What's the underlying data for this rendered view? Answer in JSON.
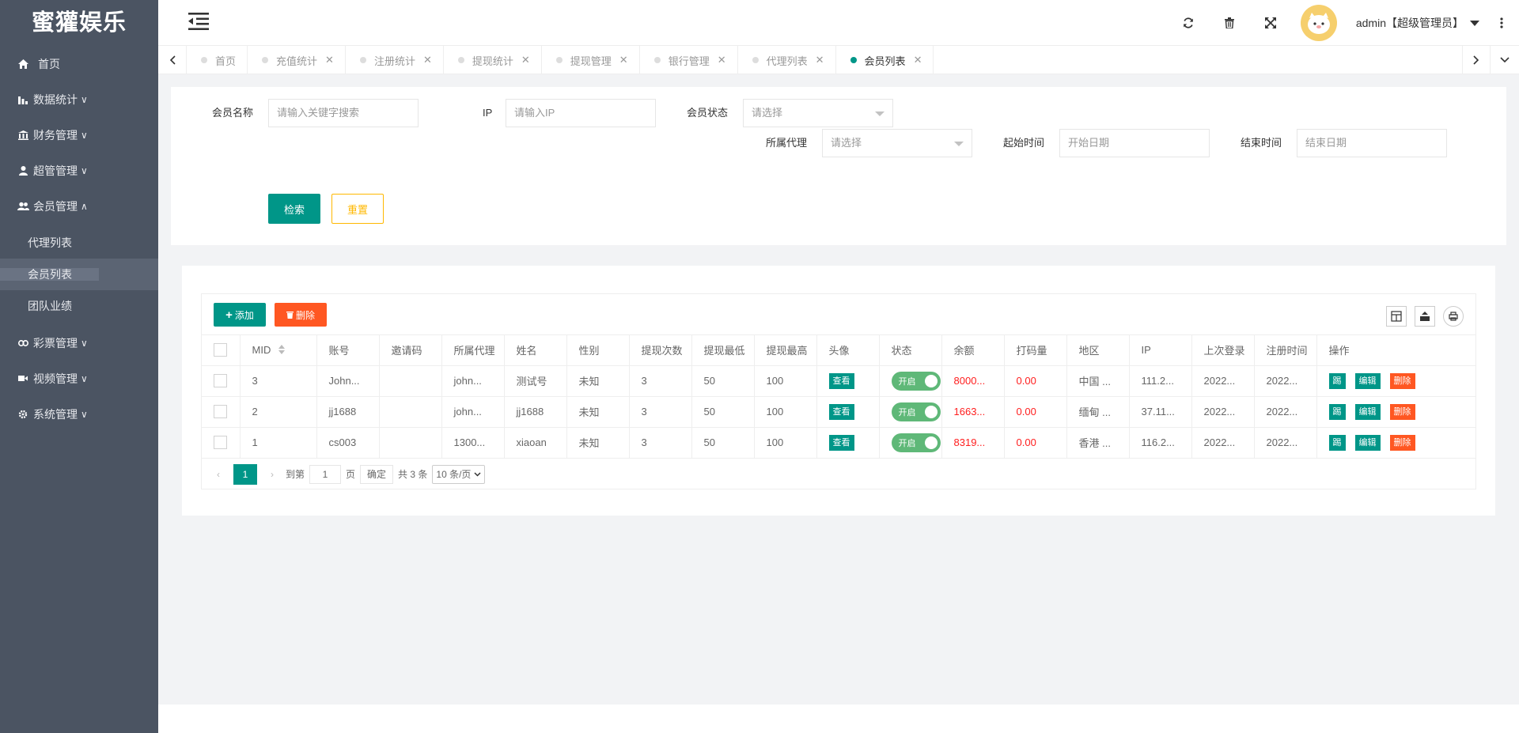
{
  "app": {
    "logo": "蜜獾娱乐"
  },
  "sidebar": {
    "items": [
      {
        "label": "首页",
        "icon": "home-icon"
      },
      {
        "label": "数据统计",
        "icon": "bar-chart-icon",
        "chevron": "∨"
      },
      {
        "label": "财务管理",
        "icon": "bank-icon",
        "chevron": "∨"
      },
      {
        "label": "超管管理",
        "icon": "user-icon",
        "chevron": "∨"
      },
      {
        "label": "会员管理",
        "icon": "users-icon",
        "chevron": "∧"
      },
      {
        "label": "彩票管理",
        "icon": "link-icon",
        "chevron": "∨"
      },
      {
        "label": "视频管理",
        "icon": "video-icon",
        "chevron": "∨"
      },
      {
        "label": "系统管理",
        "icon": "gear-icon",
        "chevron": "∨"
      }
    ],
    "sub_items": [
      {
        "label": "代理列表"
      },
      {
        "label": "会员列表"
      },
      {
        "label": "团队业绩"
      }
    ]
  },
  "header": {
    "username": "admin【超级管理员】"
  },
  "tabs": [
    {
      "label": "首页"
    },
    {
      "label": "充值统计"
    },
    {
      "label": "注册统计"
    },
    {
      "label": "提现统计"
    },
    {
      "label": "提现管理"
    },
    {
      "label": "银行管理"
    },
    {
      "label": "代理列表"
    },
    {
      "label": "会员列表"
    }
  ],
  "filters": {
    "member_name": {
      "label": "会员名称",
      "placeholder": "请输入关键字搜索"
    },
    "ip": {
      "label": "IP",
      "placeholder": "请输入IP"
    },
    "status": {
      "label": "会员状态",
      "placeholder": "请选择"
    },
    "agent": {
      "label": "所属代理",
      "placeholder": "请选择"
    },
    "start": {
      "label": "起始时间",
      "placeholder": "开始日期"
    },
    "end": {
      "label": "结束时间",
      "placeholder": "结束日期"
    },
    "search_label": "检索",
    "reset_label": "重置"
  },
  "toolbar": {
    "add_label": "添加",
    "delete_label": "删除"
  },
  "table": {
    "headers": [
      "MID",
      "账号",
      "邀请码",
      "所属代理",
      "姓名",
      "性别",
      "提现次数",
      "提现最低",
      "提现最高",
      "头像",
      "状态",
      "余额",
      "打码量",
      "地区",
      "IP",
      "上次登录",
      "注册时间",
      "操作"
    ],
    "view_label": "查看",
    "switch_label": "开启",
    "op_labels": [
      "踢",
      "编辑",
      "删除"
    ],
    "rows": [
      {
        "mid": "3",
        "account": "John...",
        "invite": "",
        "agent": "john...",
        "name": "测试号",
        "gender": "未知",
        "wd_count": "3",
        "wd_min": "50",
        "wd_max": "100",
        "balance": "8000...",
        "bet": "0.00",
        "region": "中国 ...",
        "ip": "111.2...",
        "last_login": "2022...",
        "reg_time": "2022..."
      },
      {
        "mid": "2",
        "account": "jj1688",
        "invite": "",
        "agent": "john...",
        "name": "jj1688",
        "gender": "未知",
        "wd_count": "3",
        "wd_min": "50",
        "wd_max": "100",
        "balance": "1663...",
        "bet": "0.00",
        "region": "缅甸 ...",
        "ip": "37.11...",
        "last_login": "2022...",
        "reg_time": "2022..."
      },
      {
        "mid": "1",
        "account": "cs003",
        "invite": "",
        "agent": "1300...",
        "name": "xiaoan",
        "gender": "未知",
        "wd_count": "3",
        "wd_min": "50",
        "wd_max": "100",
        "balance": "8319...",
        "bet": "0.00",
        "region": "香港 ...",
        "ip": "116.2...",
        "last_login": "2022...",
        "reg_time": "2022..."
      }
    ]
  },
  "pager": {
    "current": "1",
    "goto_label": "到第",
    "goto_value": "1",
    "page_label": "页",
    "confirm_label": "确定",
    "total_label": "共 3 条",
    "size_label": "10 条/页"
  },
  "colors": {
    "sidebar": "#4b5462",
    "primary": "#009688",
    "danger": "#FF5722",
    "warning": "#FFB800",
    "switch_on": "#5FB878",
    "balance_text": "#FF1E1E"
  }
}
